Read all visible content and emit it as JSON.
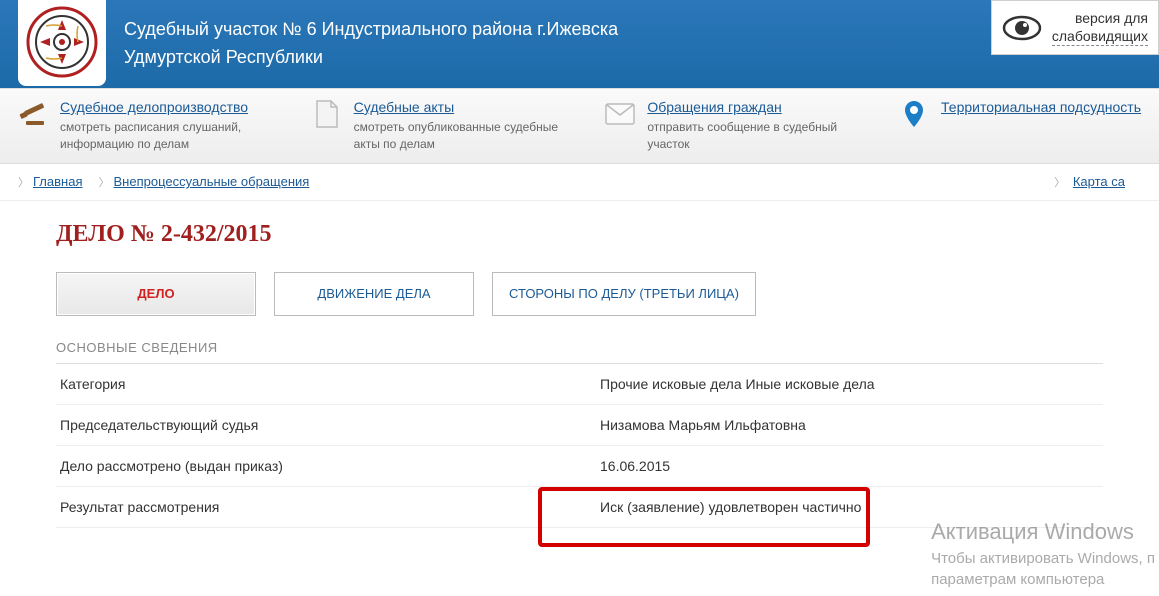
{
  "header": {
    "title_line1": "Судебный участок № 6 Индустриального района г.Ижевска",
    "title_line2": "Удмуртской Республики",
    "accessibility": "версия для\nслабовидящих"
  },
  "nav": {
    "items": [
      {
        "title": "Судебное делопроизводство",
        "desc": "смотреть расписания слушаний, информацию по делам"
      },
      {
        "title": "Судебные акты",
        "desc": "смотреть опубликованные судебные акты по делам"
      },
      {
        "title": "Обращения граждан",
        "desc": "отправить сообщение в судебный участок"
      },
      {
        "title": "Территориальная подсудность",
        "desc": ""
      }
    ]
  },
  "breadcrumb": {
    "items": [
      "Главная",
      "Внепроцессуальные обращения"
    ],
    "right": "Карта са"
  },
  "case": {
    "title": "ДЕЛО № 2-432/2015",
    "tabs": [
      "ДЕЛО",
      "ДВИЖЕНИЕ ДЕЛА",
      "СТОРОНЫ ПО ДЕЛУ (ТРЕТЬИ ЛИЦА)"
    ],
    "section": "ОСНОВНЫЕ СВЕДЕНИЯ",
    "rows": [
      {
        "label": "Категория",
        "value": "Прочие исковые дела Иные исковые дела"
      },
      {
        "label": "Председательствующий судья",
        "value": "Низамова Марьям Ильфатовна"
      },
      {
        "label": "Дело рассмотрено (выдан приказ)",
        "value": "16.06.2015"
      },
      {
        "label": "Результат рассмотрения",
        "value": "Иск (заявление) удовлетворен частично"
      }
    ]
  },
  "watermark": {
    "title": "Активация Windows",
    "desc": "Чтобы активировать Windows, п\nпараметрам компьютера"
  }
}
